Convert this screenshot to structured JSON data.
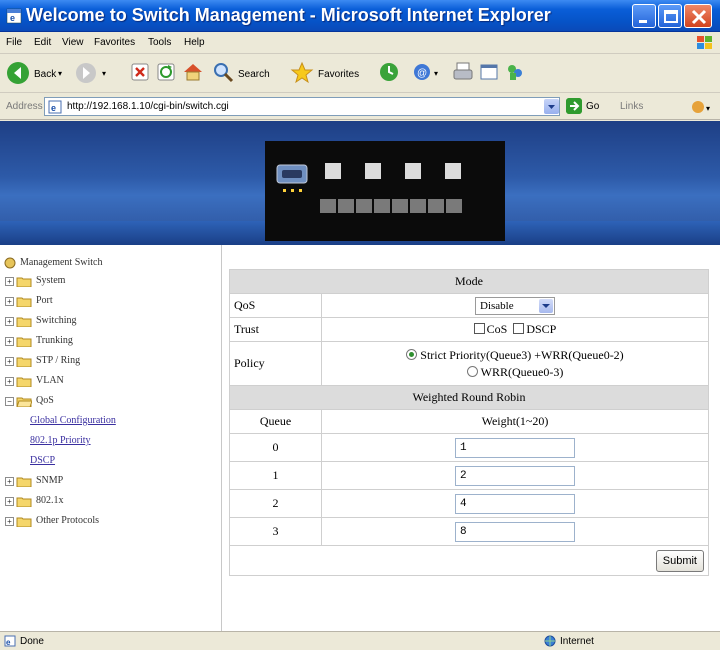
{
  "window": {
    "title": "Welcome to Switch Management - Microsoft Internet Explorer"
  },
  "menu": [
    {
      "label": "File",
      "underline": "F"
    },
    {
      "label": "Edit",
      "underline": "E"
    },
    {
      "label": "View",
      "underline": "V"
    },
    {
      "label": "Favorites",
      "underline": "a"
    },
    {
      "label": "Tools",
      "underline": "T"
    },
    {
      "label": "Help",
      "underline": "H"
    }
  ],
  "toolbar": {
    "back_label": "Back",
    "search_label": "Search",
    "favorites_label": "Favorites"
  },
  "address": {
    "label": "Address",
    "url": "http://192.168.1.10/cgi-bin/switch.cgi",
    "go_label": "Go",
    "links_label": "Links"
  },
  "sidebar": {
    "root": "Management Switch",
    "items": [
      {
        "label": "System",
        "expanded": false
      },
      {
        "label": "Port",
        "expanded": false
      },
      {
        "label": "Switching",
        "expanded": false
      },
      {
        "label": "Trunking",
        "expanded": false
      },
      {
        "label": "STP / Ring",
        "expanded": false
      },
      {
        "label": "VLAN",
        "expanded": false
      },
      {
        "label": "QoS",
        "expanded": true
      }
    ],
    "qos_links": [
      "Global Configuration",
      "802.1p Priority",
      "DSCP"
    ],
    "items_after": [
      {
        "label": "SNMP",
        "expanded": false
      },
      {
        "label": "802.1x",
        "expanded": false
      },
      {
        "label": "Other Protocols",
        "expanded": false
      }
    ]
  },
  "form": {
    "mode_header": "Mode",
    "qos_label": "QoS",
    "qos_value": "Disable",
    "trust_label": "Trust",
    "trust_cos": "CoS",
    "trust_dscp": "DSCP",
    "policy_label": "Policy",
    "policy_opt1": "Strict Priority(Queue3) +WRR(Queue0-2)",
    "policy_opt2": "WRR(Queue0-3)",
    "wrr_header": "Weighted Round Robin",
    "queue_col": "Queue",
    "weight_col": "Weight(1~20)",
    "rows": [
      {
        "queue": "0",
        "weight": "1"
      },
      {
        "queue": "1",
        "weight": "2"
      },
      {
        "queue": "2",
        "weight": "4"
      },
      {
        "queue": "3",
        "weight": "8"
      }
    ],
    "submit_label": "Submit"
  },
  "status": {
    "text": "Done",
    "zone": "Internet"
  },
  "colors": {
    "titlebar": "#0a5ed8",
    "banner": "#2d5aa8",
    "link": "#3a2fa0"
  }
}
